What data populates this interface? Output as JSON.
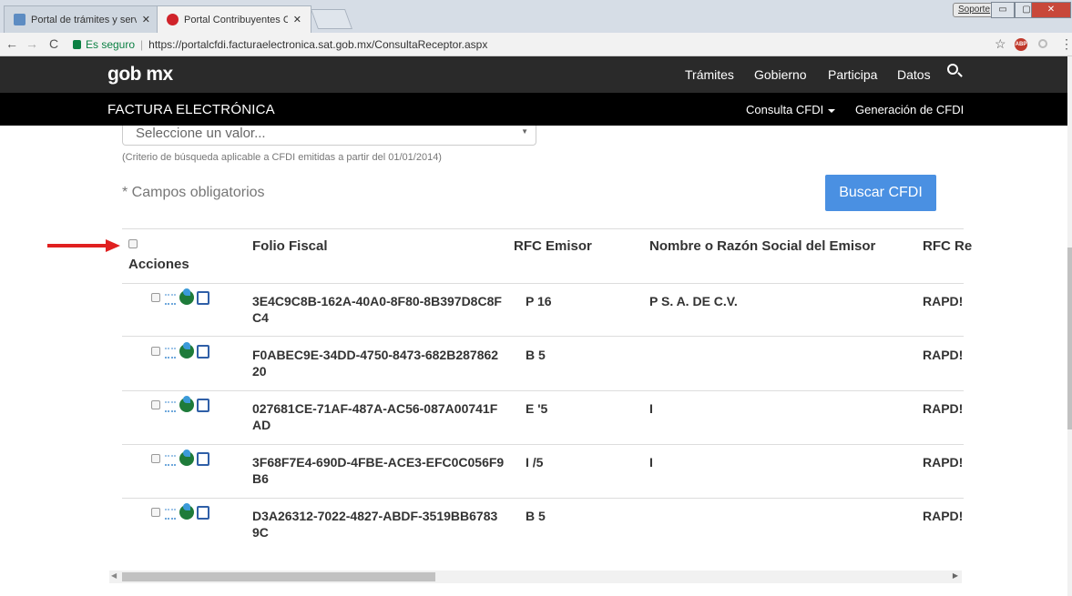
{
  "browser": {
    "tabs": [
      {
        "title": "Portal de trámites y servi"
      },
      {
        "title": "Portal Contribuyentes CF"
      }
    ],
    "soporte_label": "Soporte",
    "secure_label": "Es seguro",
    "url": "https://portalcfdi.facturaelectronica.sat.gob.mx/ConsultaReceptor.aspx"
  },
  "gob_header": {
    "logo": "gob mx",
    "nav": [
      "Trámites",
      "Gobierno",
      "Participa",
      "Datos"
    ]
  },
  "factura_header": {
    "title": "FACTURA ELECTRÓNICA",
    "nav": [
      "Consulta CFDI",
      "Generación de CFDI"
    ]
  },
  "form": {
    "select_value": "Seleccione un valor...",
    "criterio_note": "(Criterio de búsqueda aplicable a CFDI emitidas a partir del 01/01/2014)",
    "obligatorios": "* Campos obligatorios",
    "buscar_label": "Buscar CFDI"
  },
  "table": {
    "headers": [
      "Acciones",
      "Folio Fiscal",
      "RFC Emisor",
      "Nombre o Razón Social del Emisor",
      "RFC Re"
    ],
    "rows": [
      {
        "folio_1": "3E4C9C8B-162A-40A0-8F80-8B397D8C8F",
        "folio_2": "C4",
        "rfc": "P          16",
        "nombre": "P              S. A. DE C.V.",
        "rfc_receptor": "RAPD!"
      },
      {
        "folio_1": "F0ABEC9E-34DD-4750-8473-682B287862",
        "folio_2": "20",
        "rfc": "B          5",
        "nombre": "",
        "rfc_receptor": "RAPD!"
      },
      {
        "folio_1": "027681CE-71AF-487A-AC56-087A00741F",
        "folio_2": "AD",
        "rfc": "E          '5",
        "nombre": "I",
        "rfc_receptor": "RAPD!"
      },
      {
        "folio_1": "3F68F7E4-690D-4FBE-ACE3-EFC0C056F9",
        "folio_2": "B6",
        "rfc": "I          /5",
        "nombre": "I",
        "rfc_receptor": "RAPD!"
      },
      {
        "folio_1": "D3A26312-7022-4827-ABDF-3519BB6783",
        "folio_2": "9C",
        "rfc": "B          5",
        "nombre": "",
        "rfc_receptor": "RAPD!"
      }
    ]
  },
  "colors": {
    "gob_bar": "#2a2a2a",
    "factura_bar": "#000000",
    "button_blue": "#4a90e2",
    "arrow_red": "#e02020"
  }
}
